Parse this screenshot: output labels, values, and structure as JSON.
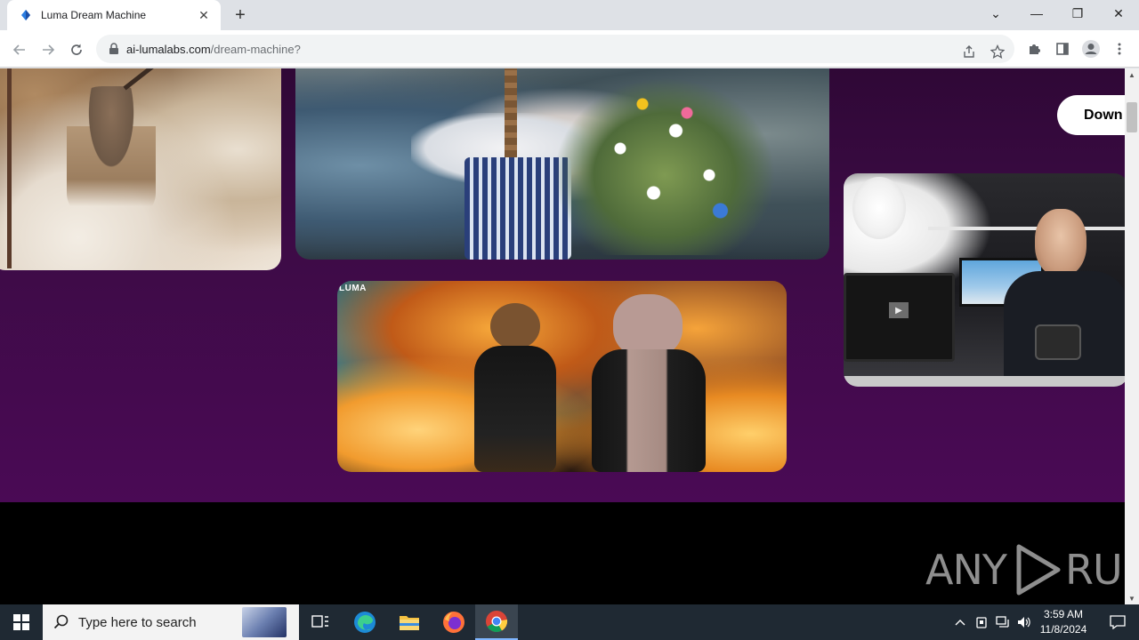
{
  "browser": {
    "tab": {
      "title": "Luma Dream Machine",
      "close": "✕"
    },
    "new_tab": "+",
    "window_controls": {
      "tab_search": "⌄",
      "minimize": "—",
      "restore": "❐",
      "close": "✕"
    },
    "url": {
      "host": "ai-lumalabs.com",
      "path": "/dream-machine?"
    }
  },
  "page": {
    "download_button": "Down",
    "explosion_logo": "LUMA",
    "play_glyph": "▶",
    "colors": {
      "background": "#3f0a47",
      "footer": "#000000"
    }
  },
  "watermark": {
    "left": "ANY",
    "right": "RUN"
  },
  "taskbar": {
    "search_placeholder": "Type here to search",
    "clock": {
      "time": "3:59 AM",
      "date": "11/8/2024"
    },
    "apps": [
      "task-view",
      "edge",
      "file-explorer",
      "firefox",
      "chrome"
    ],
    "active_app": "chrome"
  }
}
